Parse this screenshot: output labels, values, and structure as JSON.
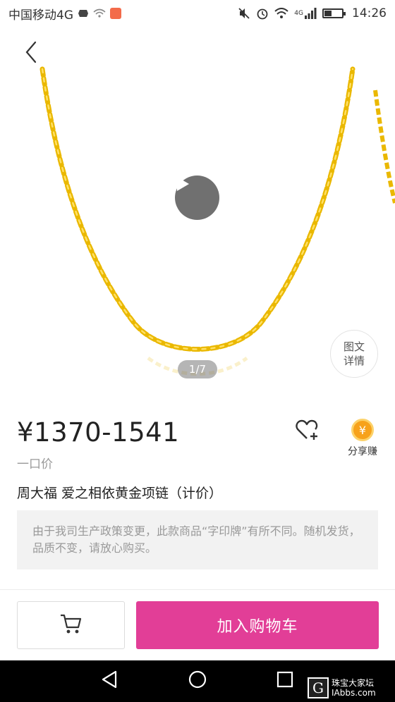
{
  "status_bar": {
    "carrier": "中国移动4G",
    "network_label": "4G",
    "time": "14:26",
    "battery_level_percent": 40
  },
  "gallery": {
    "pager": "1/7",
    "detail_button_line1": "图文",
    "detail_button_line2": "详情"
  },
  "product": {
    "price": "¥1370-1541",
    "price_label": "一口价",
    "title": "周大福 爱之相依黄金项链（计价）",
    "notice": "由于我司生产政策变更，此款商品“字印牌”有所不同。随机发货，品质不变，请放心购买。"
  },
  "actions": {
    "share_coin_symbol": "¥",
    "share_label": "分享赚",
    "add_to_cart": "加入购物车"
  },
  "watermark": {
    "logo": "G",
    "line1": "珠宝大家坛",
    "line2": "IAbbs.com"
  },
  "colors": {
    "accent_pink": "#e23e97",
    "coin_orange": "#f7a21b",
    "chain_gold": "#f2c200"
  }
}
